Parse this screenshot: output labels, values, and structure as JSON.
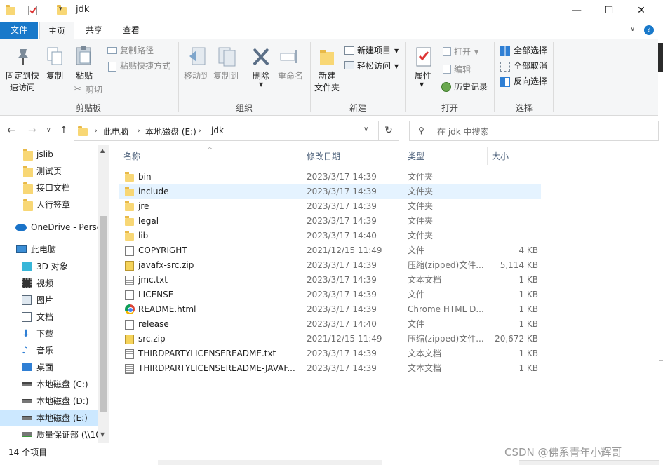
{
  "window": {
    "title": "jdk",
    "minimize": "—",
    "maximize": "☐",
    "close": "✕"
  },
  "tabs": {
    "file": "文件",
    "home": "主页",
    "share": "共享",
    "view": "查看"
  },
  "ribbon": {
    "pin_label_1": "固定到快",
    "pin_label_2": "速访问",
    "copy": "复制",
    "paste": "粘贴",
    "copy_path": "复制路径",
    "paste_shortcut": "粘贴快捷方式",
    "cut": "剪切",
    "clipboard_group": "剪贴板",
    "move_to": "移动到",
    "copy_to": "复制到",
    "delete": "删除",
    "rename": "重命名",
    "organize_group": "组织",
    "new_folder_1": "新建",
    "new_folder_2": "文件夹",
    "new_item": "新建项目",
    "easy_access": "轻松访问",
    "new_group": "新建",
    "properties": "属性",
    "open": "打开",
    "edit": "编辑",
    "history": "历史记录",
    "open_group": "打开",
    "select_all": "全部选择",
    "select_none": "全部取消",
    "invert_selection": "反向选择",
    "select_group": "选择"
  },
  "address": {
    "crumbs": [
      "此电脑",
      "本地磁盘 (E:)",
      "jdk"
    ],
    "search_placeholder": "在 jdk 中搜索"
  },
  "nav": {
    "items": [
      {
        "label": "jslib",
        "icon": "folder-icon"
      },
      {
        "label": "测试页",
        "icon": "folder-icon"
      },
      {
        "label": "接口文档",
        "icon": "folder-icon"
      },
      {
        "label": "人行签章",
        "icon": "folder-icon"
      },
      {
        "label": "OneDrive - Perso",
        "icon": "onedrive-icon"
      },
      {
        "label": "此电脑",
        "icon": "pc-icon"
      },
      {
        "label": "3D 对象",
        "icon": "3d-objects-icon"
      },
      {
        "label": "视频",
        "icon": "video-icon"
      },
      {
        "label": "图片",
        "icon": "pictures-icon"
      },
      {
        "label": "文档",
        "icon": "documents-icon"
      },
      {
        "label": "下载",
        "icon": "download-icon"
      },
      {
        "label": "音乐",
        "icon": "music-icon"
      },
      {
        "label": "桌面",
        "icon": "desktop-icon"
      },
      {
        "label": "本地磁盘 (C:)",
        "icon": "drive-icon"
      },
      {
        "label": "本地磁盘 (D:)",
        "icon": "drive-icon"
      },
      {
        "label": "本地磁盘 (E:)",
        "icon": "drive-icon"
      },
      {
        "label": "质量保证部 (\\\\10",
        "icon": "network-drive-icon"
      }
    ]
  },
  "columns": {
    "name": "名称",
    "date": "修改日期",
    "type": "类型",
    "size": "大小"
  },
  "files": [
    {
      "name": "bin",
      "date": "2023/3/17 14:39",
      "type": "文件夹",
      "size": "",
      "icon": "folder"
    },
    {
      "name": "include",
      "date": "2023/3/17 14:39",
      "type": "文件夹",
      "size": "",
      "icon": "folder"
    },
    {
      "name": "jre",
      "date": "2023/3/17 14:39",
      "type": "文件夹",
      "size": "",
      "icon": "folder"
    },
    {
      "name": "legal",
      "date": "2023/3/17 14:39",
      "type": "文件夹",
      "size": "",
      "icon": "folder"
    },
    {
      "name": "lib",
      "date": "2023/3/17 14:40",
      "type": "文件夹",
      "size": "",
      "icon": "folder"
    },
    {
      "name": "COPYRIGHT",
      "date": "2021/12/15 11:49",
      "type": "文件",
      "size": "4 KB",
      "icon": "file"
    },
    {
      "name": "javafx-src.zip",
      "date": "2023/3/17 14:39",
      "type": "压缩(zipped)文件...",
      "size": "5,114 KB",
      "icon": "zip"
    },
    {
      "name": "jmc.txt",
      "date": "2023/3/17 14:39",
      "type": "文本文档",
      "size": "1 KB",
      "icon": "text"
    },
    {
      "name": "LICENSE",
      "date": "2023/3/17 14:39",
      "type": "文件",
      "size": "1 KB",
      "icon": "file"
    },
    {
      "name": "README.html",
      "date": "2023/3/17 14:39",
      "type": "Chrome HTML D...",
      "size": "1 KB",
      "icon": "chrome"
    },
    {
      "name": "release",
      "date": "2023/3/17 14:40",
      "type": "文件",
      "size": "1 KB",
      "icon": "file"
    },
    {
      "name": "src.zip",
      "date": "2021/12/15 11:49",
      "type": "压缩(zipped)文件...",
      "size": "20,672 KB",
      "icon": "zip"
    },
    {
      "name": "THIRDPARTYLICENSEREADME.txt",
      "date": "2023/3/17 14:39",
      "type": "文本文档",
      "size": "1 KB",
      "icon": "text"
    },
    {
      "name": "THIRDPARTYLICENSEREADME-JAVAF...",
      "date": "2023/3/17 14:39",
      "type": "文本文档",
      "size": "1 KB",
      "icon": "text"
    }
  ],
  "status": {
    "count": "14 个项目"
  },
  "watermark": "CSDN @佛系青年小辉哥"
}
